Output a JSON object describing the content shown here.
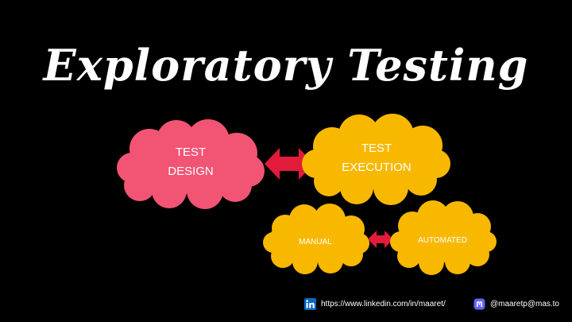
{
  "slide": {
    "title": "Exploratory Testing"
  },
  "diagram": {
    "nodes": {
      "test_design": {
        "lines": [
          "TEST",
          "DESIGN"
        ],
        "color": "#f25474"
      },
      "test_execution": {
        "lines": [
          "TEST",
          "EXECUTION"
        ],
        "color": "#f9b800"
      },
      "manual": {
        "lines": [
          "MANUAL"
        ],
        "color": "#f9b800"
      },
      "automated": {
        "lines": [
          "AUTOMATED"
        ],
        "color": "#f9b800"
      }
    },
    "arrow_color": "#e31b3b"
  },
  "footer": {
    "linkedin_icon": "linkedin-icon",
    "linkedin_url": "https://www.linkedin.com/in/maaret/",
    "mastodon_icon": "mastodon-icon",
    "mastodon_handle": "@maaretp@mas.to"
  },
  "colors": {
    "background": "#000000",
    "text": "#ffffff",
    "linkedin_brand": "#0a66c2",
    "mastodon_brand": "#6364ff"
  }
}
